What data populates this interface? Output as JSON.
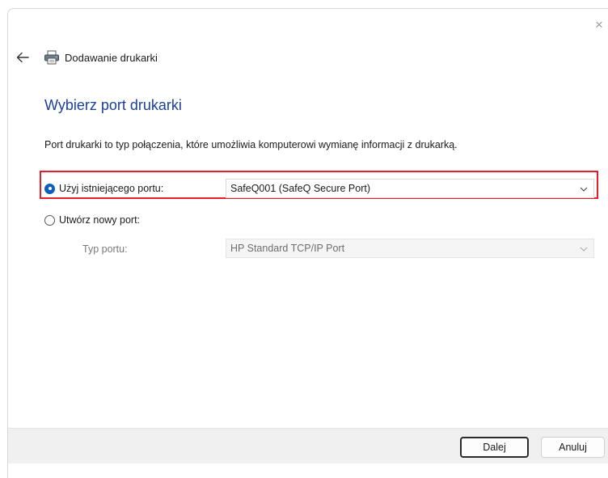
{
  "window": {
    "title": "Dodawanie drukarki",
    "close_glyph": "×"
  },
  "page": {
    "heading": "Wybierz port drukarki",
    "description": "Port drukarki to typ połączenia, które umożliwia komputerowi wymianę informacji z drukarką."
  },
  "options": {
    "existing_port": {
      "label": "Użyj istniejącego portu:",
      "selected": true,
      "value": "SafeQ001 (SafeQ Secure Port)"
    },
    "new_port": {
      "label": "Utwórz nowy port:",
      "selected": false,
      "type_label": "Typ portu:",
      "type_value": "HP Standard TCP/IP Port"
    }
  },
  "buttons": {
    "next": "Dalej",
    "cancel": "Anuluj"
  },
  "colors": {
    "accent": "#0f5fbf",
    "heading": "#1c3f9b",
    "highlight": "#e0202a"
  }
}
